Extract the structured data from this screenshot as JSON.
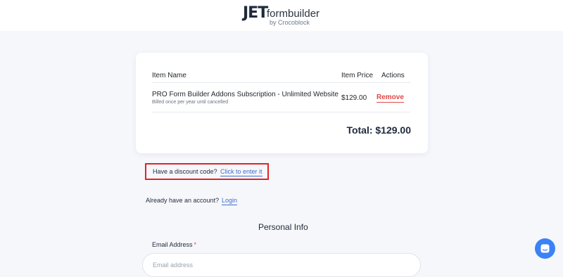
{
  "header": {
    "logo_primary": "JET",
    "logo_secondary": "formbuilder",
    "logo_byline": "by Crocoblock"
  },
  "cart": {
    "columns": {
      "name": "Item Name",
      "price": "Item Price",
      "actions": "Actions"
    },
    "items": [
      {
        "title": "PRO Form Builder Addons Subscription - Unlimited Website",
        "subtitle": "Billed once per year until cancelled",
        "price": "$129.00",
        "action": "Remove"
      }
    ],
    "total": "Total: $129.00"
  },
  "discount": {
    "label": "Have a discount code?",
    "link": "Click to enter it"
  },
  "account": {
    "label": "Already have an account?",
    "link": "Login"
  },
  "personal_info": {
    "title": "Personal Info",
    "email_label": "Email Address",
    "required_mark": "*",
    "email_placeholder": "Email address",
    "email_value": ""
  },
  "chat": {
    "icon": "chat-icon"
  },
  "colors": {
    "accent_blue": "#3b6fd0",
    "remove_red": "#e04848",
    "highlight_red": "#e02424"
  }
}
